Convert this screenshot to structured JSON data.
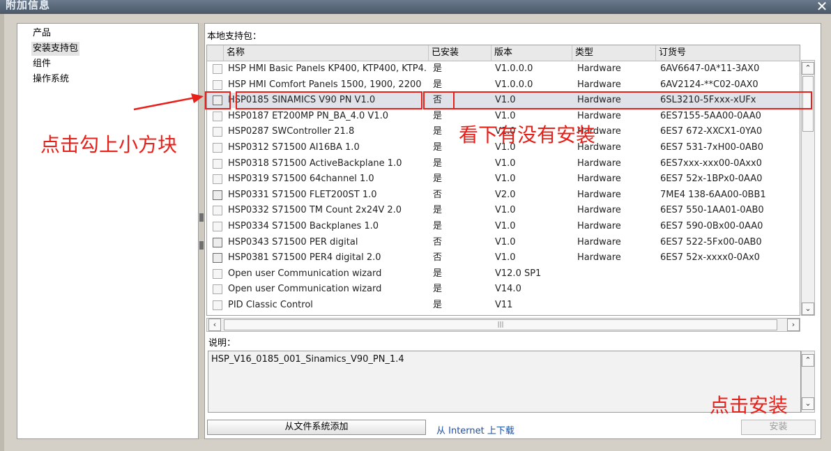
{
  "window": {
    "title": "附加信息",
    "close_glyph": "✕"
  },
  "sidebar": {
    "items": [
      {
        "label": "产品",
        "selected": false
      },
      {
        "label": "安装支持包",
        "selected": true
      },
      {
        "label": "组件",
        "selected": false
      },
      {
        "label": "操作系统",
        "selected": false
      }
    ]
  },
  "main": {
    "section_label": "本地支持包：",
    "columns": [
      "名称",
      "已安装",
      "版本",
      "类型",
      "订货号"
    ],
    "rows": [
      {
        "name": "HSP HMI Basic Panels KP400, KTP400, KTP4...",
        "installed": "是",
        "version": "V1.0.0.0",
        "type": "Hardware",
        "order": "6AV6647-0A*11-3AX0",
        "cb_dark": false
      },
      {
        "name": "HSP HMI Comfort Panels 1500, 1900, 2200",
        "installed": "是",
        "version": "V1.0.0.0",
        "type": "Hardware",
        "order": "6AV2124-**C02-0AX0",
        "cb_dark": false
      },
      {
        "name": "HSP0185 SINAMICS V90 PN V1.0",
        "installed": "否",
        "version": "V1.0",
        "type": "Hardware",
        "order": "6SL3210-5Fxxx-xUFx",
        "cb_dark": true
      },
      {
        "name": "HSP0187 ET200MP PN_BA_4.0 V1.0",
        "installed": "是",
        "version": "V1.0",
        "type": "Hardware",
        "order": "6ES7155-5AA00-0AA0",
        "cb_dark": false
      },
      {
        "name": "HSP0287 SWController 21.8",
        "installed": "是",
        "version": "V1.0",
        "type": "Hardware",
        "order": "6ES7 672-XXCX1-0YA0",
        "cb_dark": false
      },
      {
        "name": "HSP0312 S71500 AI16BA 1.0",
        "installed": "是",
        "version": "V1.0",
        "type": "Hardware",
        "order": "6ES7 531-7xH00-0AB0",
        "cb_dark": false
      },
      {
        "name": "HSP0318 S71500 ActiveBackplane 1.0",
        "installed": "是",
        "version": "V1.0",
        "type": "Hardware",
        "order": "6ES7xxx-xxx00-0Axx0",
        "cb_dark": false
      },
      {
        "name": "HSP0319 S71500 64channel 1.0",
        "installed": "是",
        "version": "V1.0",
        "type": "Hardware",
        "order": "6ES7 52x-1BPx0-0AA0",
        "cb_dark": false
      },
      {
        "name": "HSP0331 S71500 FLET200ST 1.0",
        "installed": "否",
        "version": "V2.0",
        "type": "Hardware",
        "order": "7ME4 138-6AA00-0BB1",
        "cb_dark": true
      },
      {
        "name": "HSP0332 S71500 TM Count 2x24V 2.0",
        "installed": "是",
        "version": "V1.0",
        "type": "Hardware",
        "order": "6ES7 550-1AA01-0AB0",
        "cb_dark": false
      },
      {
        "name": "HSP0334 S71500 Backplanes 1.0",
        "installed": "是",
        "version": "V1.0",
        "type": "Hardware",
        "order": "6ES7 590-0Bx00-0AA0",
        "cb_dark": false
      },
      {
        "name": "HSP0343 S71500 PER digital",
        "installed": "否",
        "version": "V1.0",
        "type": "Hardware",
        "order": "6ES7 522-5Fx00-0AB0",
        "cb_dark": true
      },
      {
        "name": "HSP0381 S71500 PER4 digital 2.0",
        "installed": "否",
        "version": "V1.0",
        "type": "Hardware",
        "order": "6ES7 52x-xxxx0-0Ax0",
        "cb_dark": true
      },
      {
        "name": "Open user Communication wizard",
        "installed": "是",
        "version": "V12.0 SP1",
        "type": "",
        "order": "",
        "cb_dark": false
      },
      {
        "name": "Open user Communication wizard",
        "installed": "是",
        "version": "V14.0",
        "type": "",
        "order": "",
        "cb_dark": false
      },
      {
        "name": "PID Classic Control",
        "installed": "是",
        "version": "V11",
        "type": "",
        "order": "",
        "cb_dark": false
      }
    ],
    "selected_row": 2,
    "description_label": "说明：",
    "description_text": "HSP_V16_0185_001_Sinamics_V90_PN_1.4",
    "add_button": "从文件系统添加",
    "download_link": "从 Internet 上下载",
    "install_button": "安装"
  },
  "annotations": {
    "click_checkbox": "点击勾上小方块",
    "check_installed": "看下有没有安装",
    "click_install": "点击安装",
    "color": "#e8201a"
  },
  "icons": {
    "scroll_up": "chevron-up-icon",
    "scroll_down": "chevron-down-icon",
    "scroll_left": "chevron-left-icon",
    "scroll_right": "chevron-right-icon"
  }
}
